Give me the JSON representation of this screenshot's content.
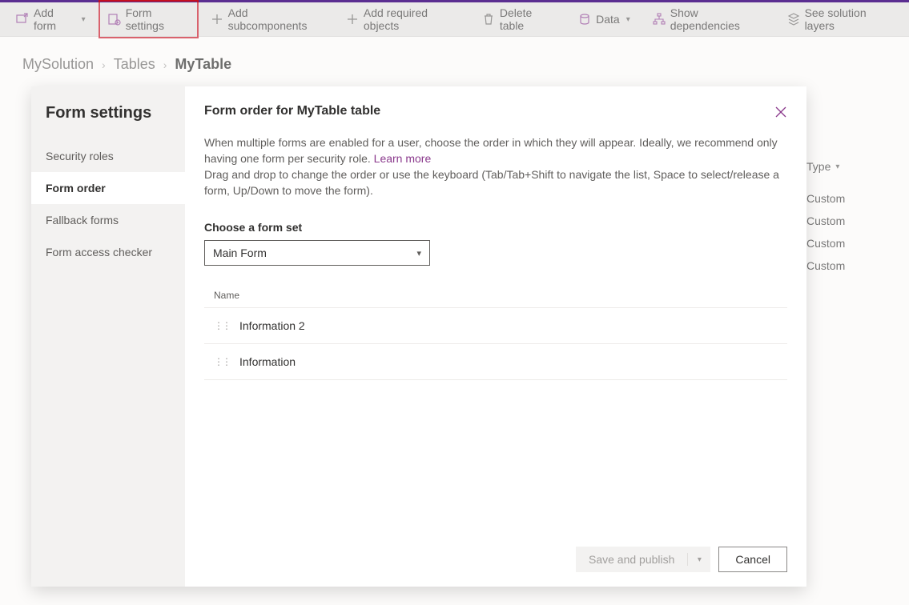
{
  "toolbar": {
    "add_form": "Add form",
    "form_settings": "Form settings",
    "add_subcomponents": "Add subcomponents",
    "add_required": "Add required objects",
    "delete_table": "Delete table",
    "data": "Data",
    "show_dependencies": "Show dependencies",
    "see_solution_layers": "See solution layers"
  },
  "breadcrumbs": {
    "root": "MySolution",
    "mid": "Tables",
    "current": "MyTable"
  },
  "bg_table": {
    "header": "Type",
    "rows": [
      "Custom",
      "Custom",
      "Custom",
      "Custom"
    ]
  },
  "dialog": {
    "sidebar_title": "Form settings",
    "nav": {
      "security_roles": "Security roles",
      "form_order": "Form order",
      "fallback_forms": "Fallback forms",
      "form_access_checker": "Form access checker"
    },
    "title": "Form order for MyTable table",
    "desc1": "When multiple forms are enabled for a user, choose the order in which they will appear. Ideally, we recommend only having one form per security role. ",
    "learn_more": "Learn more",
    "desc2": "Drag and drop to change the order or use the keyboard (Tab/Tab+Shift to navigate the list, Space to select/release a form, Up/Down to move the form).",
    "formset_label": "Choose a form set",
    "formset_value": "Main Form",
    "list_header": "Name",
    "forms": [
      "Information 2",
      "Information"
    ],
    "save_publish": "Save and publish",
    "cancel": "Cancel"
  }
}
